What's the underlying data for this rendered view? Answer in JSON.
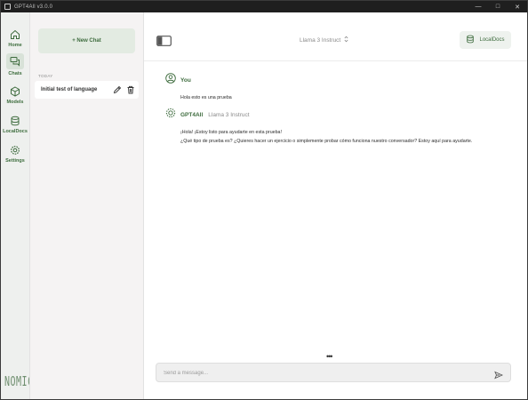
{
  "window": {
    "title": "GPT4All v3.0.0",
    "controls": [
      "minimize",
      "maximize",
      "close"
    ]
  },
  "nav": {
    "items": [
      {
        "label": "Home",
        "icon": "home-icon"
      },
      {
        "label": "Chats",
        "icon": "chat-bubbles-icon",
        "active": true
      },
      {
        "label": "Models",
        "icon": "cube-icon"
      },
      {
        "label": "LocalDocs",
        "icon": "database-icon"
      },
      {
        "label": "Settings",
        "icon": "gear-icon"
      }
    ],
    "brand": "NOMIC"
  },
  "panel": {
    "new_chat_label": "+ New Chat",
    "section_label": "TODAY",
    "chats": [
      {
        "title": "Initial test of language"
      }
    ]
  },
  "header": {
    "model_name": "Llama 3 Instruct",
    "localdocs_label": "LocalDocs"
  },
  "conversation": [
    {
      "author": "You",
      "model": "",
      "lines": [
        "Hola esto es una prueba"
      ]
    },
    {
      "author": "GPT4All",
      "model": "Llama 3 Instruct",
      "lines": [
        "¡Hola! ¡Estoy listo para ayudarte en esta prueba!",
        "¿Qué tipo de prueba es? ¿Quieres hacer un ejercicio o simplemente probar cómo funciona nuestro conversador? Estoy aquí para ayudarte."
      ]
    }
  ],
  "composer": {
    "placeholder": "Send a message...",
    "value": ""
  },
  "colors": {
    "accent": "#3d6b3d",
    "nav_bg": "#eef0ee",
    "panel_bg": "#f5f3f3",
    "titlebar_bg": "#1f1f1f"
  }
}
